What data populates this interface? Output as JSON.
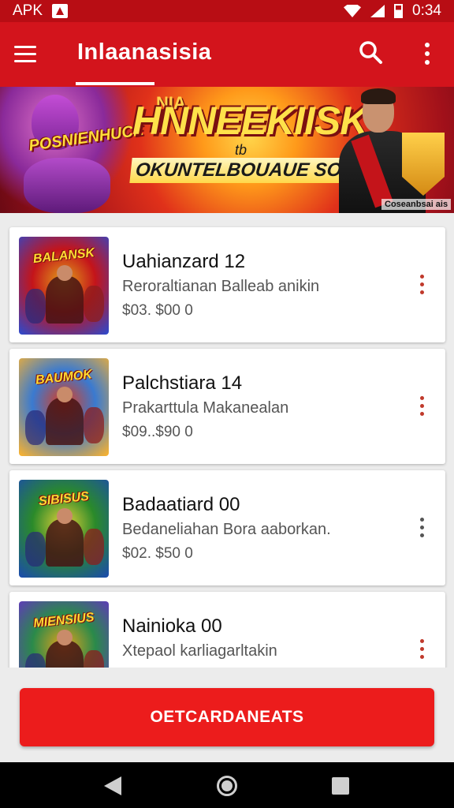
{
  "status_bar": {
    "left_text": "APK",
    "time": "0:34"
  },
  "app_bar": {
    "title": "Inlaanasisia"
  },
  "banner": {
    "top_small": "NIA",
    "headline": "HNNEEKIISK",
    "tb": "tb",
    "subheadline": "OKUNTELBOUAUE SONIC",
    "left_badge": "POSNIENHUCE",
    "caption": "Coseanbsai ais"
  },
  "items": [
    {
      "thumb_title": "BALANSK",
      "title": "Uahianzard 12",
      "subtitle": "Reroraltianan Balleab anikin",
      "price": "$03. $00 0",
      "thumb_colors": [
        "#2a4ad0",
        "#e2a21a",
        "#c4141a"
      ],
      "dots_color": "#c0392b"
    },
    {
      "thumb_title": "BAUMOK",
      "title": "Palchstiara 14",
      "subtitle": "Prakarttula Makanealan",
      "price": "$09..$90 0",
      "thumb_colors": [
        "#ffb42a",
        "#e03a1a",
        "#3a7ad0"
      ],
      "dots_color": "#c0392b"
    },
    {
      "thumb_title": "SIBISUS",
      "title": "Badaatiard 00",
      "subtitle": "Bedaneliahan Bora aaborkan.",
      "price": "$02. $50 0",
      "thumb_colors": [
        "#1a4ab0",
        "#e8d23a",
        "#2a8a2a"
      ],
      "dots_color": "#555555"
    },
    {
      "thumb_title": "MIENSIUS",
      "title": "Nainioka 00",
      "subtitle": "Xtepaol karliagarltakin",
      "price": "",
      "thumb_colors": [
        "#6a2ad0",
        "#e8a21a",
        "#2a8a4a"
      ],
      "dots_color": "#c0392b"
    }
  ],
  "action_button": {
    "label": "OETCARDANEATS"
  },
  "colors": {
    "app_bar": "#d3141c",
    "accent": "#ec1c1c"
  },
  "icons": [
    "menu-icon",
    "search-icon",
    "more-vert-icon",
    "back-icon",
    "home-icon",
    "recents-icon"
  ]
}
